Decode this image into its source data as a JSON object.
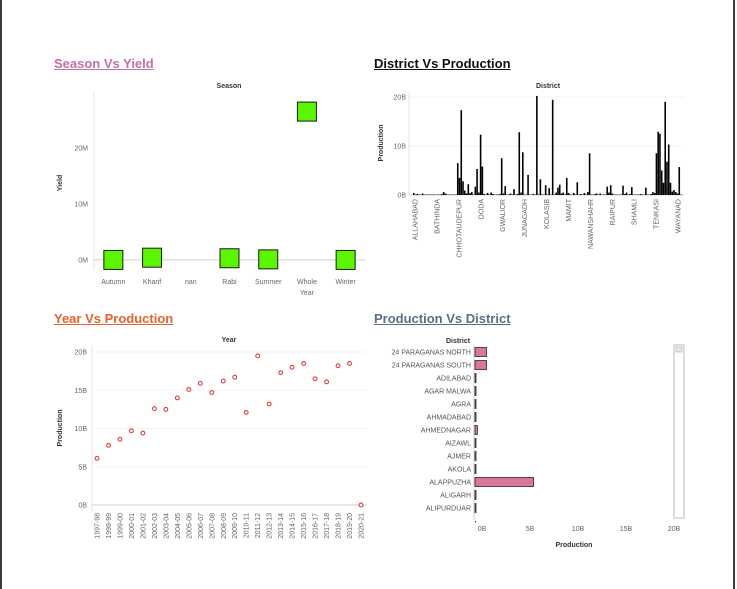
{
  "titles": {
    "season_yield": "Season Vs Yield",
    "district_production": "District Vs Production",
    "year_production": "Year Vs Production",
    "production_district": "Production Vs District"
  },
  "colors": {
    "season_title": "#c46fa8",
    "district_title": "#111111",
    "year_title": "#e8612c",
    "prod_district_title": "#5a6f88",
    "green_fill": "#5cf500",
    "bar_black": "#000000",
    "dot_red": "#d94040",
    "pink_bar": "#d9769a"
  },
  "chart_data": [
    {
      "id": "season_yield",
      "type": "scatter",
      "title": "Season Vs Yield",
      "header": "Season",
      "ylabel": "Yield",
      "categories": [
        "Autumn",
        "Kharif",
        "nan",
        "Rabi",
        "Summer",
        "Whole Year",
        "Winter"
      ],
      "values": [
        0,
        400000,
        null,
        300000,
        100000,
        26500000,
        0
      ],
      "y_ticks": [
        0,
        10000000,
        20000000
      ],
      "y_tick_labels": [
        "0M",
        "10M",
        "20M"
      ],
      "ylim": [
        -1800000,
        30000000
      ]
    },
    {
      "id": "district_production",
      "type": "bar",
      "title": "District Vs Production",
      "header": "District",
      "ylabel": "Production",
      "x_tick_labels": [
        "ALLAHABAD",
        "BATHINDA",
        "CHHOTAUDEPUR",
        "DODA",
        "GWALIOR",
        "JUNAGADH",
        "KOLASIB",
        "MAMIT",
        "NAWANSHAHR",
        "RAIPUR",
        "SHAMLI",
        "TENKASI",
        "WAYANAD"
      ],
      "y_ticks": [
        0,
        10000000000,
        20000000000
      ],
      "y_tick_labels": [
        "0B",
        "10B",
        "20B"
      ],
      "ylim": [
        0,
        21000000000
      ],
      "values_billions": [
        0.4,
        0.1,
        0.2,
        0.1,
        0.0,
        0.3,
        0.1,
        0.0,
        0.1,
        0.0,
        0.0,
        0.1,
        0.0,
        0.0,
        0.0,
        0.0,
        0.2,
        0.6,
        0.3,
        0.1,
        0.0,
        0.0,
        0.1,
        0.0,
        0.1,
        6.5,
        3.5,
        17.3,
        2.8,
        0.9,
        0.3,
        2.2,
        0.4,
        0.6,
        0.1,
        1.7,
        5.3,
        0.5,
        12.3,
        5.8,
        0.2,
        0.0,
        0.4,
        0.0,
        0.5,
        0.2,
        0.0,
        0.1,
        0.0,
        0.2,
        7.5,
        0.3,
        1.8,
        0.0,
        0.1,
        0.3,
        0.0,
        1.2,
        0.0,
        0.2,
        12.8,
        0.5,
        8.7,
        0.0,
        0.0,
        4.1,
        0.0,
        0.0,
        0.2,
        0.0,
        20.2,
        0.0,
        3.2,
        0.1,
        0.0,
        2.0,
        0.0,
        1.4,
        0.0,
        19.4,
        0.0,
        0.5,
        1.5,
        2.1,
        0.3,
        0.5,
        0.1,
        3.5,
        0.4,
        0.1,
        0.0,
        0.4,
        0.1,
        2.6,
        0.0,
        0.2,
        0.0,
        0.4,
        0.1,
        0.6,
        8.5,
        0.1,
        0.0,
        0.2,
        0.3,
        0.0,
        0.3,
        0.0,
        0.1,
        0.1,
        1.7,
        0.5,
        2.0,
        0.3,
        0.0,
        0.1,
        0.0,
        0.0,
        0.1,
        1.9,
        0.2,
        0.5,
        0.0,
        0.2,
        1.6,
        0.0,
        0.0,
        0.1,
        0.0,
        0.2,
        0.1,
        0.0,
        1.5,
        0.0,
        0.0,
        0.2,
        0.6,
        0.4,
        8.5,
        12.9,
        12.5,
        5.0,
        2.5,
        19.0,
        6.8,
        10.3,
        2.5,
        0.7,
        1.0,
        0.6,
        0.3,
        5.7,
        0.1
      ]
    },
    {
      "id": "year_production",
      "type": "scatter",
      "title": "Year Vs Production",
      "header": "Year",
      "ylabel": "Production",
      "x": [
        "1997-98",
        "1998-99",
        "1999-00",
        "2000-01",
        "2001-02",
        "2002-03",
        "2003-04",
        "2004-05",
        "2005-06",
        "2006-07",
        "2007-08",
        "2008-09",
        "2009-10",
        "2010-11",
        "2011-12",
        "2012-13",
        "2013-14",
        "2014-15",
        "2015-16",
        "2016-17",
        "2017-18",
        "2018-19",
        "2019-20",
        "2020-21"
      ],
      "values_billions": [
        6.1,
        7.8,
        8.6,
        9.7,
        9.4,
        12.6,
        12.5,
        14.0,
        15.1,
        15.9,
        14.7,
        16.2,
        16.7,
        12.1,
        19.5,
        13.2,
        17.3,
        18.0,
        18.5,
        16.5,
        16.1,
        18.2,
        18.5,
        0.0
      ],
      "y_ticks": [
        0,
        5000000000,
        10000000000,
        15000000000,
        20000000000
      ],
      "y_tick_labels": [
        "0B",
        "5B",
        "10B",
        "15B",
        "20B"
      ],
      "ylim": [
        0,
        20000000000
      ]
    },
    {
      "id": "production_district",
      "type": "bar",
      "orientation": "horizontal",
      "title": "Production Vs District",
      "header": "District",
      "xlabel": "Production",
      "categories": [
        "24 PARAGANAS NORTH",
        "24 PARAGANAS SOUTH",
        "ADILABAD",
        "AGAR MALWA",
        "AGRA",
        "AHMADABAD",
        "AHMEDNAGAR",
        "AIZAWL",
        "AJMER",
        "AKOLA",
        "ALAPPUZHA",
        "ALIGARH",
        "ALIPURDUAR"
      ],
      "values_billions": [
        1.2,
        1.2,
        0.05,
        0.05,
        0.08,
        0.1,
        0.25,
        0.05,
        0.05,
        0.05,
        6.1,
        0.1,
        0.1
      ],
      "x_ticks": [
        0,
        5000000000,
        10000000000,
        15000000000,
        20000000000
      ],
      "x_tick_labels": [
        "0B",
        "5B",
        "10B",
        "15B",
        "20B"
      ],
      "xlim": [
        0,
        20000000000
      ]
    }
  ]
}
